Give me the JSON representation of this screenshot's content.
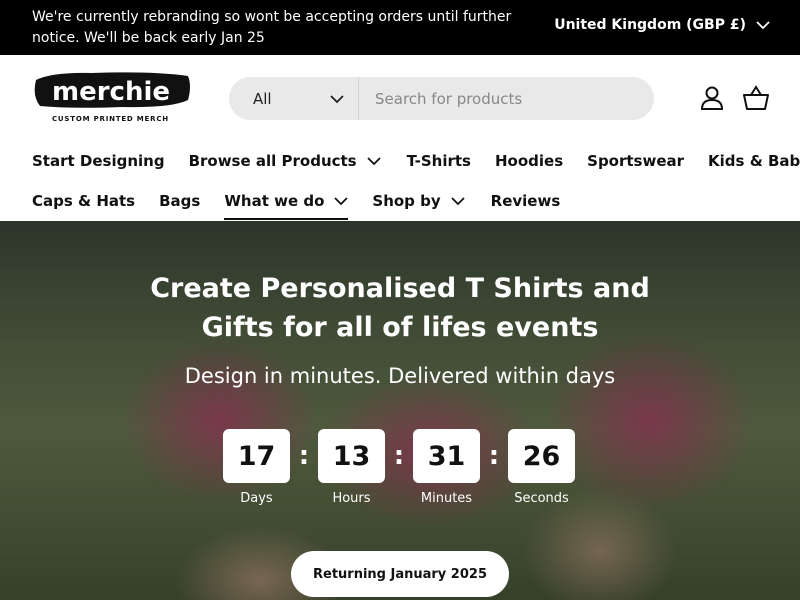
{
  "announcement": {
    "text": "We're currently rebranding so wont be accepting orders until further notice. We'll be back early Jan 25",
    "currency": "United Kingdom (GBP £)",
    "currency_icon": "chevron-down-icon"
  },
  "header": {
    "logo_text": "merchie",
    "logo_tagline": "CUSTOM PRINTED MERCH",
    "search": {
      "category": "All",
      "placeholder": "Search for products"
    },
    "icons": [
      "user-icon",
      "basket-icon"
    ]
  },
  "nav": {
    "row1": [
      {
        "label": "Start Designing",
        "dropdown": false
      },
      {
        "label": "Browse all Products",
        "dropdown": true
      },
      {
        "label": "T-Shirts",
        "dropdown": false
      },
      {
        "label": "Hoodies",
        "dropdown": false
      },
      {
        "label": "Sportswear",
        "dropdown": false
      },
      {
        "label": "Kids & Baby",
        "dropdown": false
      }
    ],
    "row2": [
      {
        "label": "Caps & Hats",
        "dropdown": false
      },
      {
        "label": "Bags",
        "dropdown": false
      },
      {
        "label": "What we do",
        "dropdown": true,
        "active": true
      },
      {
        "label": "Shop by",
        "dropdown": true
      },
      {
        "label": "Reviews",
        "dropdown": false
      }
    ]
  },
  "hero": {
    "title": "Create Personalised T Shirts and Gifts for all of lifes events",
    "subtitle": "Design in minutes. Delivered within days",
    "countdown": [
      {
        "value": "17",
        "label": "Days"
      },
      {
        "value": "13",
        "label": "Hours"
      },
      {
        "value": "31",
        "label": "Minutes"
      },
      {
        "value": "26",
        "label": "Seconds"
      }
    ],
    "separator": ":",
    "button_label": "Returning January 2025"
  },
  "colors": {
    "announcement_bg": "#000000",
    "search_bg": "#e9e9e9",
    "hero_accent": "#dc2878",
    "text": "#111111"
  }
}
